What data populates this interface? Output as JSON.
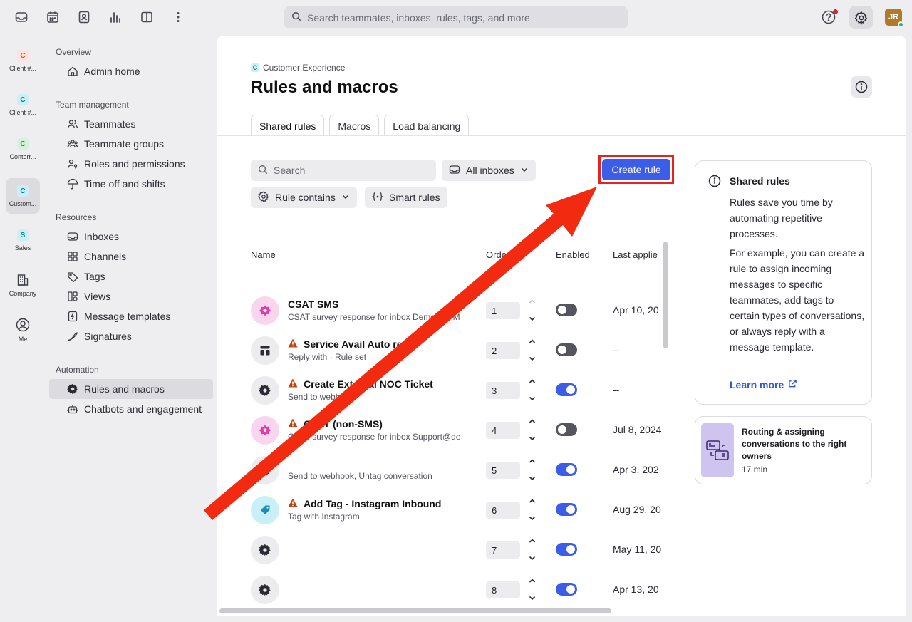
{
  "topbar": {
    "search_placeholder": "Search teammates, inboxes, rules, tags, and more",
    "avatar_initials": "JR"
  },
  "workspaces": [
    {
      "badge": "C",
      "label": "Client #...",
      "color": "#fde4dc",
      "text_color": "#d2522f"
    },
    {
      "badge": "C",
      "label": "Client #...",
      "color": "#cbeff5",
      "text_color": "#0c7e92"
    },
    {
      "badge": "C",
      "label": "Conterr...",
      "color": "#d4f1dc",
      "text_color": "#23884a"
    },
    {
      "badge": "C",
      "label": "Custom...",
      "color": "#cbeff5",
      "text_color": "#0c7e92"
    },
    {
      "badge": "S",
      "label": "Sales",
      "color": "#cbeff5",
      "text_color": "#0c7e92"
    },
    {
      "label": "Company"
    },
    {
      "label": "Me"
    }
  ],
  "nav": {
    "overview_header": "Overview",
    "admin_home": "Admin home",
    "team_header": "Team management",
    "teammates": "Teammates",
    "teammate_groups": "Teammate groups",
    "roles": "Roles and permissions",
    "timeoff": "Time off and shifts",
    "resources_header": "Resources",
    "inboxes": "Inboxes",
    "channels": "Channels",
    "tags": "Tags",
    "views": "Views",
    "templates": "Message templates",
    "signatures": "Signatures",
    "automation_header": "Automation",
    "rules": "Rules and macros",
    "chatbots": "Chatbots and engagement"
  },
  "page": {
    "breadcrumb_badge": "C",
    "breadcrumb": "Customer Experience",
    "title": "Rules and macros",
    "tabs": [
      "Shared rules",
      "Macros",
      "Load balancing"
    ],
    "search_placeholder": "Search",
    "inbox_filter": "All inboxes",
    "rule_contains": "Rule contains",
    "smart_rules": "Smart rules",
    "create_rule": "Create rule"
  },
  "table": {
    "headers": {
      "name": "Name",
      "order": "Orde",
      "enabled": "Enabled",
      "last_applied": "Last applie"
    },
    "rows": [
      {
        "title": "CSAT SMS",
        "sub": "CSAT survey response for inbox Demo GC M",
        "order": "1",
        "enabled": false,
        "date": "Apr 10, 20",
        "icon": "star",
        "warn": false
      },
      {
        "title": "Service Avail Auto reply",
        "sub": "Reply with · Rule set",
        "order": "2",
        "enabled": false,
        "date": "--",
        "icon": "ruleset",
        "warn": true
      },
      {
        "title": "Create External NOC Ticket",
        "sub": "Send to webhook",
        "order": "3",
        "enabled": true,
        "date": "--",
        "icon": "gear",
        "warn": true
      },
      {
        "title": "CSAT (non-SMS)",
        "sub": "CSAT survey response for inbox Support@de",
        "order": "4",
        "enabled": false,
        "date": "Jul 8, 2024",
        "icon": "star",
        "warn": true
      },
      {
        "title": "",
        "sub": "Send to webhook, Untag conversation",
        "order": "5",
        "enabled": true,
        "date": "Apr 3, 202",
        "icon": "gear",
        "warn": false
      },
      {
        "title": "Add Tag - Instagram Inbound",
        "sub": "Tag with Instagram",
        "order": "6",
        "enabled": true,
        "date": "Aug 29, 20",
        "icon": "tag",
        "warn": true
      },
      {
        "title": "",
        "sub": "",
        "order": "7",
        "enabled": true,
        "date": "May 11, 20",
        "icon": "gear",
        "warn": false
      },
      {
        "title": "",
        "sub": "",
        "order": "8",
        "enabled": true,
        "date": "Apr 13, 20",
        "icon": "gear",
        "warn": false
      }
    ]
  },
  "info_card": {
    "title": "Shared rules",
    "p1": "Rules save you time by automating repetitive processes.",
    "p2": "For example, you can create a rule to assign incoming messages to specific teammates, add tags to certain types of conversations, or always reply with a message template.",
    "link": "Learn more"
  },
  "video_card": {
    "title": "Routing & assigning conversations to the right owners",
    "duration": "17 min"
  },
  "colors": {
    "accent": "#3b5de7",
    "annotation": "#e8231b",
    "warning": "#c2410c"
  }
}
